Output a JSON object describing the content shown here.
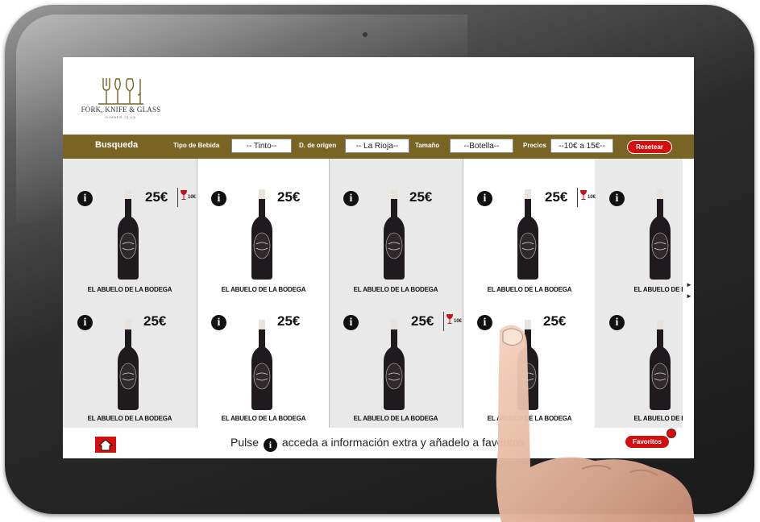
{
  "brand": {
    "name": "FORK, KNIFE & GLASS",
    "tagline": "DINNER CLUB"
  },
  "toolbar": {
    "title": "Busqueda",
    "filters": [
      {
        "label": "Tipo de Bebida",
        "value": "-- Tinto--"
      },
      {
        "label": "D. de origen",
        "value": "-- La Rioja--"
      },
      {
        "label": "Tamaño",
        "value": "--Botella--"
      },
      {
        "label": "Precios",
        "value": "--10€ a 15€--"
      }
    ],
    "reset_label": "Resetear"
  },
  "products": [
    {
      "name": "EL ABUELO DE LA BODEGA",
      "price": "25€",
      "glass_price": "10€"
    },
    {
      "name": "EL ABUELO DE LA BODEGA",
      "price": "25€",
      "glass_price": ""
    },
    {
      "name": "EL ABUELO DE LA BODEGA",
      "price": "25€",
      "glass_price": ""
    },
    {
      "name": "EL ABUELO DE LA BODEGA",
      "price": "25€",
      "glass_price": "10€"
    },
    {
      "name": "EL ABUELO DE LA",
      "price": "",
      "glass_price": ""
    },
    {
      "name": "EL ABUELO DE LA BODEGA",
      "price": "25€",
      "glass_price": ""
    },
    {
      "name": "EL ABUELO DE LA BODEGA",
      "price": "25€",
      "glass_price": ""
    },
    {
      "name": "EL ABUELO DE LA BODEGA",
      "price": "25€",
      "glass_price": "10€"
    },
    {
      "name": "EL ABUELO DE LA BODEGA",
      "price": "25€",
      "glass_price": ""
    },
    {
      "name": "EL ABUELO DE LA",
      "price": "",
      "glass_price": ""
    }
  ],
  "footer": {
    "hint_before": "Pulse",
    "hint_after": "acceda a información extra y añadelo a favoritos",
    "favorites_label": "Favoritos"
  },
  "icons": {
    "info": "info-icon",
    "home": "home-icon",
    "glass": "wine-glass-icon",
    "next": "arrow-right-icon"
  },
  "colors": {
    "toolbar": "#7a6424",
    "accent": "#d40f0f"
  }
}
